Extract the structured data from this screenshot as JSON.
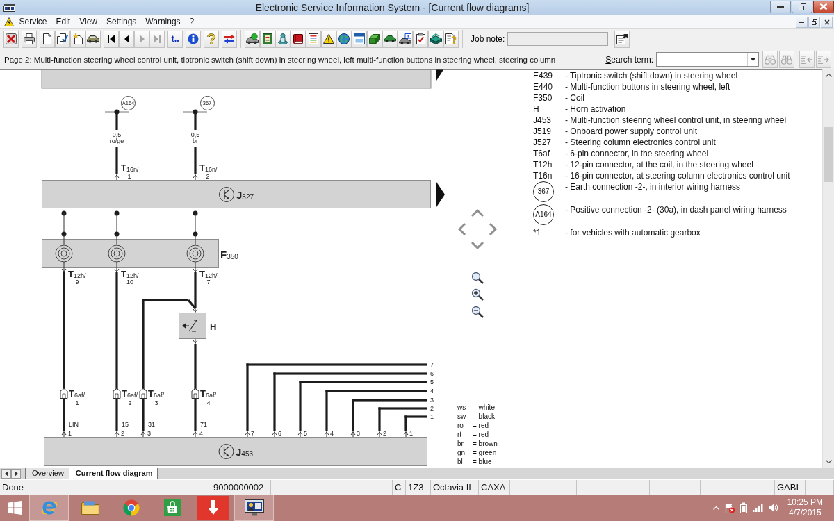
{
  "window": {
    "title": "Electronic Service Information System - [Current flow diagrams]"
  },
  "menu": [
    "Service",
    "Edit",
    "View",
    "Settings",
    "Warnings",
    "?"
  ],
  "toolbar": {
    "navigation": [
      {
        "disabled": false
      },
      {
        "disabled": false
      },
      {
        "disabled": true
      },
      {
        "disabled": true
      }
    ],
    "goto_button": "t..",
    "job_note": {
      "label": "Job note:"
    }
  },
  "page_bar": {
    "title": "Page 2: Multi-function steering wheel control unit, tiptronic switch (shift down) in steering wheel, left multi-function buttons in steering wheel, steering column",
    "search": {
      "label": "Search term:"
    },
    "search_buttons": [
      {
        "disabled": true
      },
      {
        "disabled": true
      },
      {
        "disabled": true
      },
      {
        "disabled": true
      }
    ]
  },
  "diagram": {
    "terminals": [
      {
        "label": "A164",
        "cross_section": "0,5",
        "wire_color": "ro/ge",
        "connector": "**T**$_{16n/}$",
        "pin": "1"
      },
      {
        "label": "367",
        "cross_section": "0,5",
        "wire_color": "br",
        "connector": "**T**$_{16n/}$",
        "pin": "2"
      }
    ],
    "upper_unit": {
      "label": "**J**$_{527}$"
    },
    "coil": {
      "label": "**F**$_{350}$",
      "outputs": [
        {
          "connector": "**T**$_{12h/}$",
          "pin": "9"
        },
        {
          "connector": "**T**$_{12h/}$",
          "pin": "10"
        },
        {
          "connector": "**T**$_{12h/}$",
          "pin": "7"
        }
      ]
    },
    "horn_switch": {
      "label": "H"
    },
    "wheel_connectors": [
      {
        "connector": "**T**$_{6af/}$",
        "pin": "1",
        "signal": "LIN",
        "unit_pin": "1"
      },
      {
        "connector": "**T**$_{6af/}$",
        "pin": "2",
        "signal": "15",
        "unit_pin": "2"
      },
      {
        "connector": "**T**$_{6af/}$",
        "pin": "3",
        "signal": "31",
        "unit_pin": "3"
      },
      {
        "connector": "**T**$_{6af/}$",
        "pin": "4",
        "signal": "71",
        "unit_pin": "4"
      }
    ],
    "button_lines": [
      {
        "unit_pin": "7",
        "end": "7"
      },
      {
        "unit_pin": "6",
        "end": "6"
      },
      {
        "unit_pin": "5",
        "end": "5"
      },
      {
        "unit_pin": "4",
        "end": "4"
      },
      {
        "unit_pin": "3",
        "end": "3"
      },
      {
        "unit_pin": "2",
        "end": "2"
      },
      {
        "unit_pin": "1",
        "end": "1"
      }
    ],
    "lower_unit": {
      "label": "**J**$_{453}$"
    },
    "color_codes": [
      {
        "code": "ws",
        "meaning": "= white"
      },
      {
        "code": "sw",
        "meaning": "= black"
      },
      {
        "code": "ro",
        "meaning": "= red"
      },
      {
        "code": "rt",
        "meaning": "= red"
      },
      {
        "code": "br",
        "meaning": "= brown"
      },
      {
        "code": "gn",
        "meaning": "= green"
      },
      {
        "code": "bl",
        "meaning": "= blue"
      }
    ]
  },
  "legend": [
    {
      "kind": "text",
      "code": "E439",
      "description": "- Tiptronic switch (shift down) in steering wheel"
    },
    {
      "kind": "text",
      "code": "E440",
      "description": "- Multi-function buttons in steering wheel, left"
    },
    {
      "kind": "text",
      "code": "F350",
      "description": "- Coil"
    },
    {
      "kind": "text",
      "code": "H",
      "description": "- Horn activation"
    },
    {
      "kind": "text",
      "code": "J453",
      "description": "- Multi-function steering wheel control unit, in steering wheel"
    },
    {
      "kind": "text",
      "code": "J519",
      "description": "- Onboard power supply control unit"
    },
    {
      "kind": "text",
      "code": "J527",
      "description": "- Steering column electronics control unit"
    },
    {
      "kind": "text",
      "code": "T6af",
      "description": "- 6-pin connector, in the steering wheel"
    },
    {
      "kind": "text",
      "code": "T12h",
      "description": "- 12-pin connector, at the coil, in the steering wheel"
    },
    {
      "kind": "text",
      "code": "T16n",
      "description": "- 16-pin connector, at steering column electronics control unit"
    },
    {
      "kind": "circle",
      "code": "367",
      "description": "- Earth connection -2-, in interior wiring harness"
    },
    {
      "kind": "circle",
      "code": "A164",
      "description": "- Positive connection -2- (30a), in dash panel wiring harness"
    },
    {
      "kind": "text",
      "code": "*1",
      "description": "- for vehicles with automatic gearbox"
    }
  ],
  "sheet_tabs": [
    {
      "label": "Overview",
      "selected": false
    },
    {
      "label": "Current flow diagram",
      "selected": true
    }
  ],
  "status_bar": [
    "Done",
    "9000000002",
    "C",
    "1Z3",
    "Octavia II",
    "CAXA",
    "GABI"
  ],
  "taskbar": {
    "apps": [
      {
        "running": true
      },
      {
        "running": false
      },
      {
        "running": false
      },
      {
        "running": false
      },
      {
        "running": false
      },
      {
        "running": true
      }
    ],
    "clock": {
      "time": "10:25 PM",
      "date": "4/7/2015"
    }
  }
}
